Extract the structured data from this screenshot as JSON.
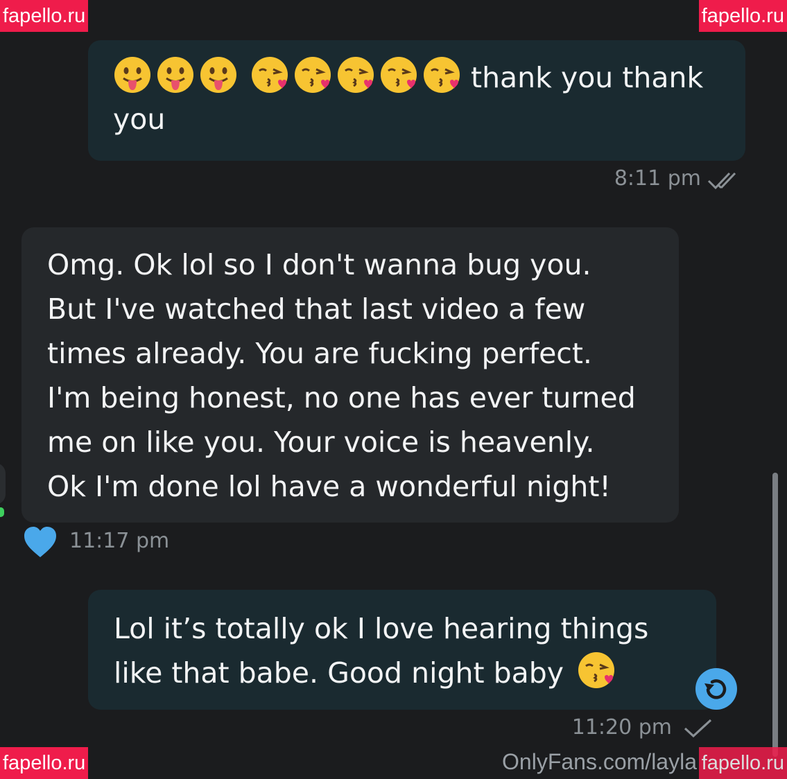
{
  "watermark": "fapello.ru",
  "messages": [
    {
      "direction": "outgoing",
      "emojis": [
        "tongue-out",
        "tongue-out",
        "tongue-out",
        "kiss-heart",
        "kiss-heart",
        "kiss-heart",
        "kiss-heart",
        "kiss-heart"
      ],
      "text_line1": "thank you thank",
      "text_line2": "you",
      "time": "8:11 pm",
      "status": "double-check-icon"
    },
    {
      "direction": "incoming",
      "lines": [
        "Omg. Ok lol so I don't wanna bug you.",
        "But I've watched that last video a few",
        "times already. You are fucking perfect.",
        "I'm being honest, no one has ever turned",
        "me on like you. Your voice is heavenly.",
        "Ok I'm done lol have a wonderful night!"
      ],
      "reaction": "blue-heart-icon",
      "time": "11:17 pm"
    },
    {
      "direction": "outgoing",
      "line1": "Lol it’s totally ok I love hearing things",
      "line2": "like that babe. Good night baby",
      "emoji": "kiss-heart",
      "time": "11:20 pm",
      "status": "check-icon"
    }
  ],
  "footer_url": "OnlyFans.com/layla",
  "colors": {
    "background": "#1b1c1e",
    "outgoing_bubble": "#1a2a30",
    "incoming_bubble": "#25282b",
    "accent_blue": "#4aa8ea",
    "watermark_red": "#ef1c4b"
  }
}
